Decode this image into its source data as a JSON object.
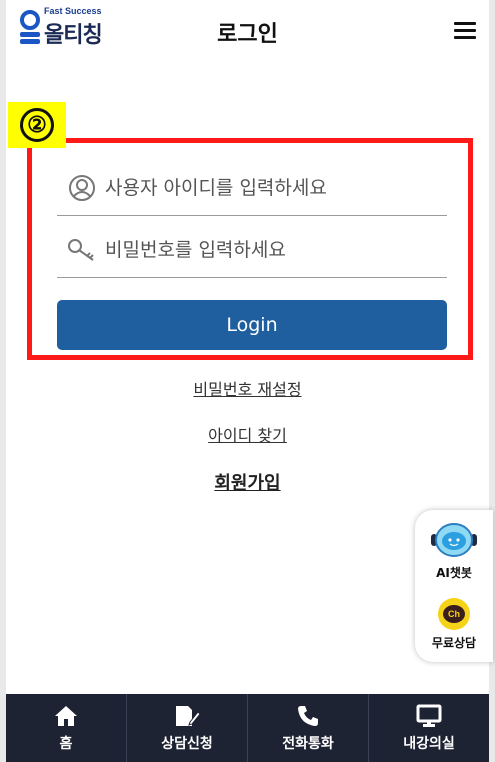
{
  "header": {
    "logo_tagline": "Fast Success",
    "logo_name": "올티칭",
    "title": "로그인"
  },
  "annotation": {
    "step_number": "②"
  },
  "login_form": {
    "id_placeholder": "사용자 아이디를 입력하세요",
    "password_placeholder": "비밀번호를 입력하세요",
    "login_button": "Login"
  },
  "links": {
    "reset_password": "비밀번호 재설정",
    "find_id": "아이디 찾기",
    "sign_up": "회원가입"
  },
  "floating_widget": {
    "ai_chatbot_label": "AI챗봇",
    "kakao_icon_text": "Ch",
    "free_consult_label": "무료상담"
  },
  "bottom_nav": {
    "items": [
      {
        "label": "홈",
        "icon": "home-icon"
      },
      {
        "label": "상담신청",
        "icon": "document-edit-icon"
      },
      {
        "label": "전화통화",
        "icon": "phone-icon"
      },
      {
        "label": "내강의실",
        "icon": "monitor-icon"
      }
    ]
  },
  "colors": {
    "accent": "#1f5fa0",
    "highlight_box": "#ff1a1a",
    "badge": "#ffff00",
    "nav_background": "#1e2334",
    "kakao": "#f5d318"
  }
}
